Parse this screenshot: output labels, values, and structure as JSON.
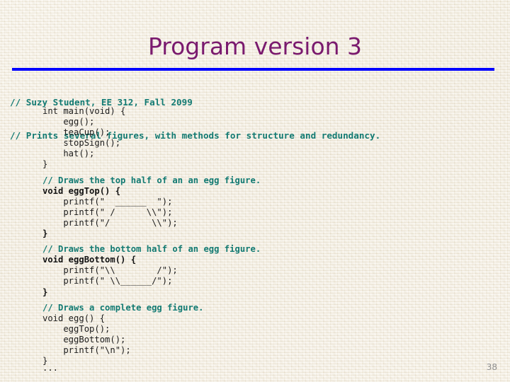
{
  "slide": {
    "title": "Program version 3",
    "page_number": "38",
    "accent_rule_color": "#0000FF",
    "title_color": "#7A1A6E",
    "comment_color": "#127A72",
    "code_color": "#1C1C1C",
    "background_color": "#EFE8D7"
  },
  "header_comments": [
    "// Suzy Student, EE 312, Fall 2099",
    "// Prints several figures, with methods for structure and redundancy."
  ],
  "code": {
    "blocks": [
      {
        "name": "main-block",
        "lines": [
          {
            "kind": "plain",
            "text": "int main(void) {"
          },
          {
            "kind": "plain",
            "text": "    egg();"
          },
          {
            "kind": "plain",
            "text": "    teaCup();"
          },
          {
            "kind": "plain",
            "text": "    stopSign();"
          },
          {
            "kind": "plain",
            "text": "    hat();"
          },
          {
            "kind": "plain",
            "text": "}"
          }
        ]
      },
      {
        "name": "eggtop-block",
        "lines": [
          {
            "kind": "comment",
            "text": "// Draws the top half of an an egg figure."
          },
          {
            "kind": "signature",
            "text": "void eggTop() {"
          },
          {
            "kind": "plain",
            "text": "    printf(\"  ______  \");"
          },
          {
            "kind": "plain",
            "text": "    printf(\" /      \\\\\");"
          },
          {
            "kind": "plain",
            "text": "    printf(\"/        \\\\\");"
          },
          {
            "kind": "signature",
            "text": "}"
          }
        ]
      },
      {
        "name": "eggbottom-block",
        "lines": [
          {
            "kind": "comment",
            "text": "// Draws the bottom half of an egg figure."
          },
          {
            "kind": "signature",
            "text": "void eggBottom() {"
          },
          {
            "kind": "plain",
            "text": "    printf(\"\\\\        /\");"
          },
          {
            "kind": "plain",
            "text": "    printf(\" \\\\______/\");"
          },
          {
            "kind": "signature",
            "text": "}"
          }
        ]
      },
      {
        "name": "egg-block",
        "lines": [
          {
            "kind": "comment",
            "text": "// Draws a complete egg figure."
          },
          {
            "kind": "plain",
            "text": "void egg() {"
          },
          {
            "kind": "plain",
            "text": "    eggTop();"
          },
          {
            "kind": "plain",
            "text": "    eggBottom();"
          },
          {
            "kind": "plain",
            "text": "    printf(\"\\n\");"
          },
          {
            "kind": "plain",
            "text": "}"
          }
        ]
      }
    ],
    "ellipsis": "..."
  }
}
